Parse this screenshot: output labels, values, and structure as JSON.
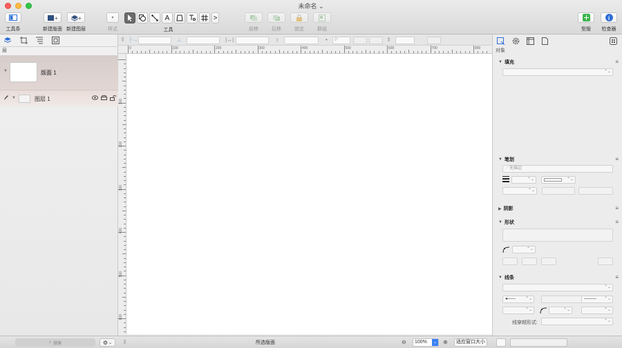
{
  "window": {
    "title": "未命名 ⌄"
  },
  "toolbar": {
    "toolbar_label": "工具条",
    "new_canvas": "新建版面",
    "new_layer": "新建图层",
    "style": "样式",
    "tools": "工具",
    "tool_text_glyph": "A",
    "tool_more_glyph": ">",
    "forward": "前移",
    "backward": "后移",
    "lock": "锁定",
    "group": "群组",
    "stencils": "型版",
    "inspector": "检查器"
  },
  "sidebar": {
    "header": "层",
    "canvas_name": "版面 1",
    "layer_name": "图层 1"
  },
  "subbar": {
    "rotation_value": "0°"
  },
  "rulers": {
    "h_labels": [
      "0",
      "100",
      "200",
      "300",
      "400",
      "500",
      "600",
      "700",
      "800"
    ],
    "v_labels": [
      "100",
      "200",
      "300",
      "400",
      "500",
      "600"
    ]
  },
  "inspector": {
    "header": "对象",
    "fill": "填充",
    "stroke": "笔划",
    "no_stroke": "无描边",
    "shadow": "阴影",
    "shape": "形状",
    "lines": "线条",
    "line_hop": "线穿越形式:"
  },
  "bottombar": {
    "search_placeholder": "搜索",
    "selection": "所选版面",
    "zoom": "100%",
    "fit_window": "适应窗口大小"
  },
  "colors": {
    "accent": "#3b82f6",
    "stencils_green": "#3cb44b",
    "inspector_blue": "#2f6fd6"
  }
}
